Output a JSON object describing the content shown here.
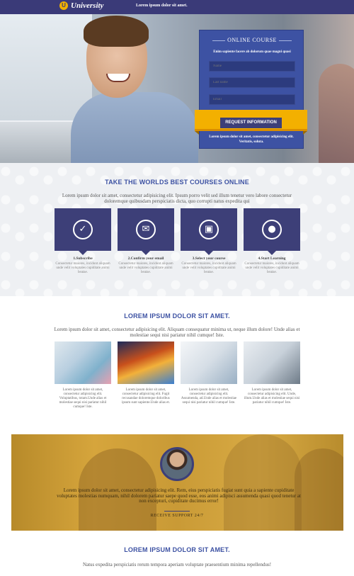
{
  "header": {
    "logo_letter": "U",
    "logo_text": "University",
    "tagline": "Lorem ipsum dolor sit amet."
  },
  "hero": {
    "form": {
      "title": "ONLINE COURSE",
      "subtitle": "Enim sapiente facere ab dolorum quae magni quasi",
      "name_placeholder": "Name",
      "lastname_placeholder": "Last name",
      "email_placeholder": "Email",
      "button_label": "REQUEST INFORMATION",
      "note": "Lorem ipsum dolor sit amet, consectetur adipisicing elit. Veritatis, soluta."
    }
  },
  "steps_section": {
    "title": "TAKE THE WORLDS BEST COURSES ONLINE",
    "description": "Lorem ipsum dolor sit amet, consectetur adipisicing elit. Ipsum porro velit sed illum tenetur vero labore consectetur doloremque quibusdam perspiciatis dicta, quo corrupti natus expedita qui",
    "steps": [
      {
        "icon": "check-icon",
        "label": "1.Subscribe",
        "text": "Consectetur maiores, incidunt aliquam unde velit voluptates cupiditate animi beatae."
      },
      {
        "icon": "email-icon",
        "label": "2.Confirm your email",
        "text": "Consectetur maiores, incidunt aliquam unde velit voluptates cupiditate animi beatae."
      },
      {
        "icon": "image-icon",
        "label": "3.Select your course",
        "text": "Consectetur maiores, incidunt aliquam unde velit voluptates cupiditate animi beatae."
      },
      {
        "icon": "user-icon",
        "label": "4.Start Learning",
        "text": "Consectetur maiores, incidunt aliquam unde velit voluptates cupiditate animi beatae."
      }
    ]
  },
  "gallery_section": {
    "title": "LOREM IPSUM DOLOR SIT AMET.",
    "description": "Lorem ipsum dolor sit amet, consectetur adipisicing elit. Aliquam consequatur minima ut, neque illum dolore! Unde alias et molestiae sequi nisi pariatur nihil cumque! Iste.",
    "items": [
      {
        "text": "Lorem ipsum dolor sit amet, consectetur adipisicing elit. Voluptatibus, totam.Unde alias et molestiae sequi nisi pariatur nihil cumque! Iste."
      },
      {
        "text": "Lorem ipsum dolor sit amet, consectetur adipisicing elit. Fugit recusandae doloremque doloribus ipsum sunt sapiente.Unde alias et."
      },
      {
        "text": "Lorem ipsum dolor sit amet, consectetur adipisicing elit. Assumenda, ad.Unde alias et molestiae sequi nisi pariatur nihil cumque! Iste."
      },
      {
        "text": "Lorem ipsum dolor sit amet, consectetur adipisicing elit. Unde, illum.Unde alias et molestiae sequi nisi pariatur nihil cumque! Iste."
      }
    ]
  },
  "testimonial": {
    "quote": "Lorem ipsum dolor sit amet, consectetur adipisicing elit. Rem, eius perspiciatis fugiat sunt quia a sapiente cupiditate voluptates molestias numquam, nihil dolorem pariatur saepe quod esse, eos animi adipisci assumenda quasi quod tenetur at non excepturi, cupiditate ducimus error!",
    "support_label": "RECEIVE SUPPORT 24/7"
  },
  "final_section": {
    "title": "LOREM IPSUM DOLOR SIT AMET.",
    "description": "Natus expedita perspiciatis rerum tempora aperiam voluptate praesentium minima repellendus!"
  },
  "colors": {
    "primary": "#3d3f78",
    "accent_blue": "#3d52a3",
    "accent_yellow": "#f3b000"
  }
}
